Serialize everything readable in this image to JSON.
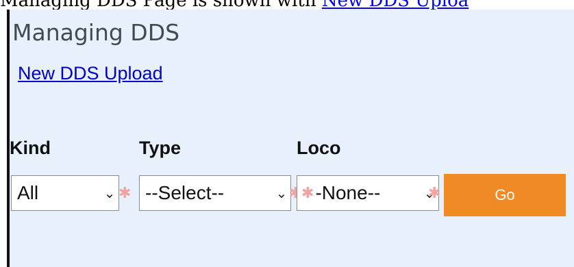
{
  "caption": {
    "text": "Managing DDS Page is shown with ",
    "link_text": "New DDS Uploa"
  },
  "page": {
    "title": "Managing DDS",
    "upload_link": "New DDS Upload"
  },
  "filters": {
    "kind": {
      "label": "Kind",
      "selected": "All"
    },
    "type": {
      "label": "Type",
      "selected": "--Select--"
    },
    "loco": {
      "label": "Loco",
      "selected": "-None--"
    }
  },
  "actions": {
    "go_label": "Go"
  },
  "colors": {
    "panel_bg": "#e7f0fb",
    "go_button": "#f08a24",
    "link": "#0000cc"
  }
}
